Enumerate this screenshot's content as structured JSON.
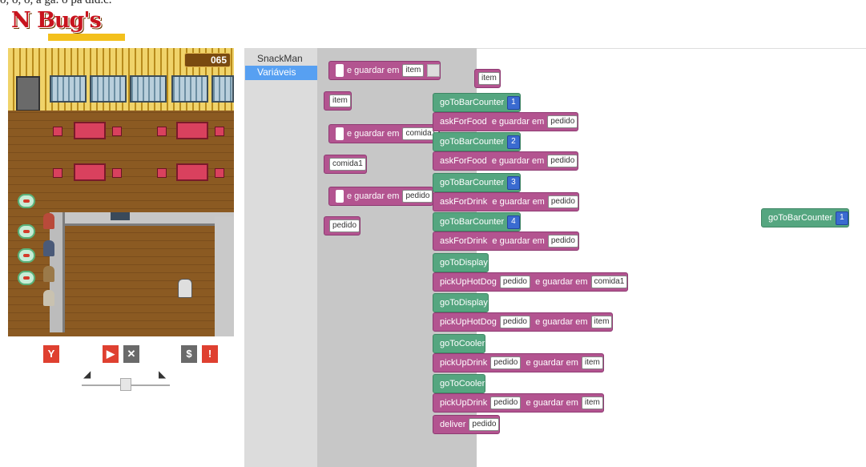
{
  "caption": "o, o, o, a ga. o pa did.c.",
  "logo": {
    "text": "N Bug's"
  },
  "game": {
    "score": "065",
    "colors": {
      "wall": "#f0d36a",
      "floor": "#8b5a22",
      "table": "#d9415e",
      "bubble": "#59b27a"
    }
  },
  "controls": {
    "item1": "Y",
    "play": "▶",
    "stop": "✕",
    "money": "$",
    "alert": "!",
    "slow_icon": "turtle-icon",
    "fast_icon": "rabbit-icon"
  },
  "toolbox": {
    "items": [
      {
        "label": "SnackMan"
      },
      {
        "label": "Variáveis"
      }
    ]
  },
  "flyout": {
    "set_item": {
      "label": "e guardar em",
      "var": "item"
    },
    "get_item": {
      "var": "item"
    },
    "set_comida": {
      "label": "e guardar em",
      "var": "comida1"
    },
    "get_comida": {
      "var": "comida1"
    },
    "set_pedido": {
      "label": "e guardar em",
      "var": "pedido"
    },
    "get_pedido": {
      "var": "pedido"
    }
  },
  "program": {
    "top_var": "item",
    "blocks": [
      {
        "kind": "goToBarCounter",
        "label": "goToBarCounter",
        "num": "1"
      },
      {
        "kind": "askForFood",
        "label": "askForFood",
        "store": "e guardar em",
        "var": "pedido"
      },
      {
        "kind": "goToBarCounter",
        "label": "goToBarCounter",
        "num": "2"
      },
      {
        "kind": "askForFood",
        "label": "askForFood",
        "store": "e guardar em",
        "var": "pedido"
      },
      {
        "kind": "goToBarCounter",
        "label": "goToBarCounter",
        "num": "3"
      },
      {
        "kind": "askForDrink",
        "label": "askForDrink",
        "store": "e guardar em",
        "var": "pedido"
      },
      {
        "kind": "goToBarCounter",
        "label": "goToBarCounter",
        "num": "4"
      },
      {
        "kind": "askForDrink",
        "label": "askForDrink",
        "store": "e guardar em",
        "var": "pedido"
      },
      {
        "kind": "goToDisplay",
        "label": "goToDisplay"
      },
      {
        "kind": "pickUpHotDog",
        "label": "pickUpHotDog",
        "arg": "pedido",
        "store": "e guardar em",
        "var": "comida1"
      },
      {
        "kind": "goToDisplay",
        "label": "goToDisplay"
      },
      {
        "kind": "pickUpHotDog",
        "label": "pickUpHotDog",
        "arg": "pedido",
        "store": "e guardar em",
        "var": "item"
      },
      {
        "kind": "goToCooler",
        "label": "goToCooler"
      },
      {
        "kind": "pickUpDrink",
        "label": "pickUpDrink",
        "arg": "pedido",
        "store": "e guardar em",
        "var": "item"
      },
      {
        "kind": "goToCooler",
        "label": "goToCooler"
      },
      {
        "kind": "pickUpDrink",
        "label": "pickUpDrink",
        "arg": "pedido",
        "store": "e guardar em",
        "var": "item"
      },
      {
        "kind": "deliver",
        "label": "deliver",
        "var": "pedido"
      }
    ],
    "loose": {
      "label": "goToBarCounter",
      "num": "1"
    }
  }
}
